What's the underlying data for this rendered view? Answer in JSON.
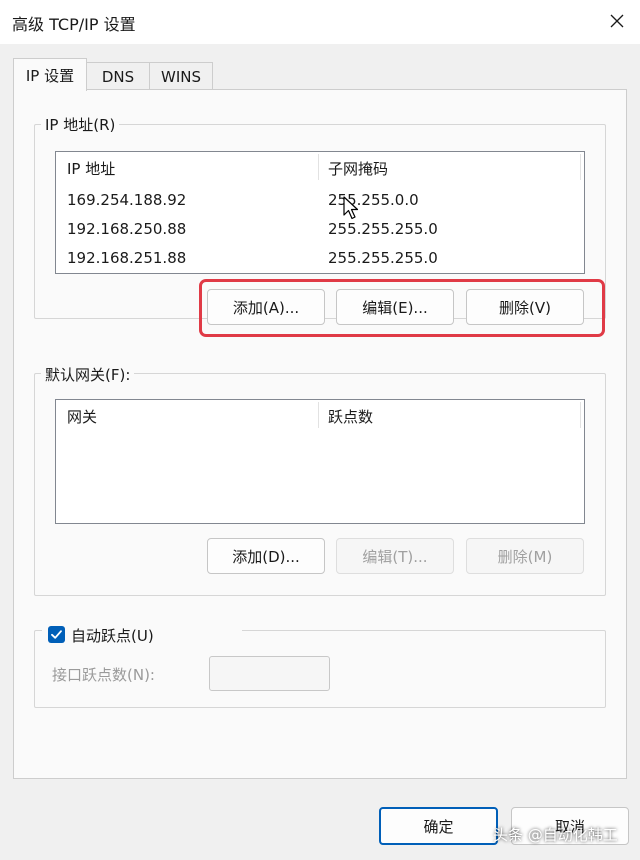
{
  "window": {
    "title": "高级 TCP/IP 设置",
    "close_icon": "close-icon"
  },
  "tabs": [
    {
      "label": "IP 设置",
      "active": true
    },
    {
      "label": "DNS",
      "active": false
    },
    {
      "label": "WINS",
      "active": false
    }
  ],
  "ip_group": {
    "label": "IP 地址(R)",
    "columns": [
      "IP 地址",
      "子网掩码"
    ],
    "rows": [
      {
        "ip": "169.254.188.92",
        "mask": "255.255.0.0"
      },
      {
        "ip": "192.168.250.88",
        "mask": "255.255.255.0"
      },
      {
        "ip": "192.168.251.88",
        "mask": "255.255.255.0"
      }
    ],
    "add_label": "添加(A)...",
    "edit_label": "编辑(E)...",
    "delete_label": "删除(V)"
  },
  "gateway_group": {
    "label": "默认网关(F):",
    "columns": [
      "网关",
      "跃点数"
    ],
    "add_label": "添加(D)...",
    "edit_label": "编辑(T)...",
    "delete_label": "删除(M)"
  },
  "metric": {
    "checkbox_label": "自动跃点(U)",
    "checked": true,
    "interface_metric_label": "接口跃点数(N):",
    "interface_metric_value": ""
  },
  "footer": {
    "ok_label": "确定",
    "cancel_label": "取消"
  },
  "watermark": "头条 @自动化韩工",
  "colors": {
    "accent": "#005fb8",
    "highlight": "#e03a46"
  }
}
